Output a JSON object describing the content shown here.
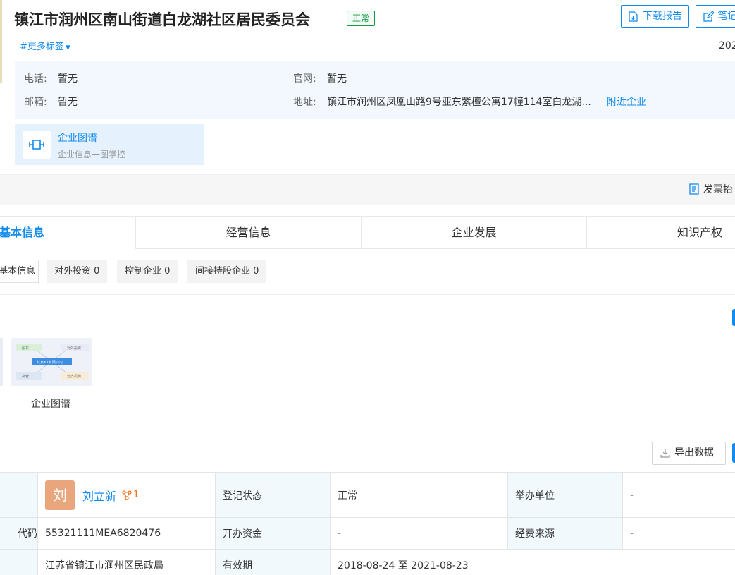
{
  "header": {
    "company_name": "镇江市润州区南山街道白龙湖社区居民委员会",
    "status": "正常",
    "more_tags": "#更多标签",
    "download_label": "下载报告",
    "notes_label": "笔记",
    "year_partial": "202"
  },
  "contact": {
    "phone_label": "电话:",
    "phone_value": "暂无",
    "website_label": "官网:",
    "website_value": "暂无",
    "email_label": "邮箱:",
    "email_value": "暂无",
    "address_label": "地址:",
    "address_value": "镇江市润州区凤凰山路9号亚东紫檀公寓17幢114室白龙湖...",
    "nearby_link": "附近企业"
  },
  "graph_card": {
    "title": "企业图谱",
    "subtitle": "企业信息一图掌控"
  },
  "strip": {
    "invoice_label": "发票抬"
  },
  "tabs": [
    {
      "label": "基本信息",
      "active": true
    },
    {
      "label": "经营信息",
      "active": false
    },
    {
      "label": "企业发展",
      "active": false
    },
    {
      "label": "知识产权",
      "active": false
    }
  ],
  "subtabs": [
    {
      "label": "基本信息",
      "active": true
    },
    {
      "label": "对外投资 0",
      "active": false
    },
    {
      "label": "控制企业 0",
      "active": false
    },
    {
      "label": "间接持股企业 0",
      "active": false
    }
  ],
  "thumbnail": {
    "label": "企业图谱",
    "nodes": {
      "shareholder": "股东",
      "investment": "对外投资",
      "center": "北京XX有限公司",
      "executive": "高管",
      "branch": "分支机构"
    }
  },
  "export_label": "导出数据",
  "table": {
    "row1": {
      "avatar_char": "刘",
      "person_name": "刘立新",
      "relation_count": "1",
      "reg_status_label": "登记状态",
      "reg_status_value": "正常",
      "sponsor_label": "举办单位",
      "sponsor_value": "-"
    },
    "row2": {
      "code_label_partial": "代码",
      "code_value": "55321111MEA6820476",
      "capital_label": "开办资金",
      "capital_value": "-",
      "funding_label": "经费来源",
      "funding_value": "-"
    },
    "row3": {
      "authority_value": "江苏省镇江市润州区民政局",
      "validity_label": "有效期",
      "validity_value": "2018-08-24 至 2021-08-23"
    }
  },
  "colors": {
    "accent": "#128bed",
    "status_green": "#129a43",
    "avatar_bg": "#e9a57c",
    "relation_orange": "#ff6d16"
  }
}
